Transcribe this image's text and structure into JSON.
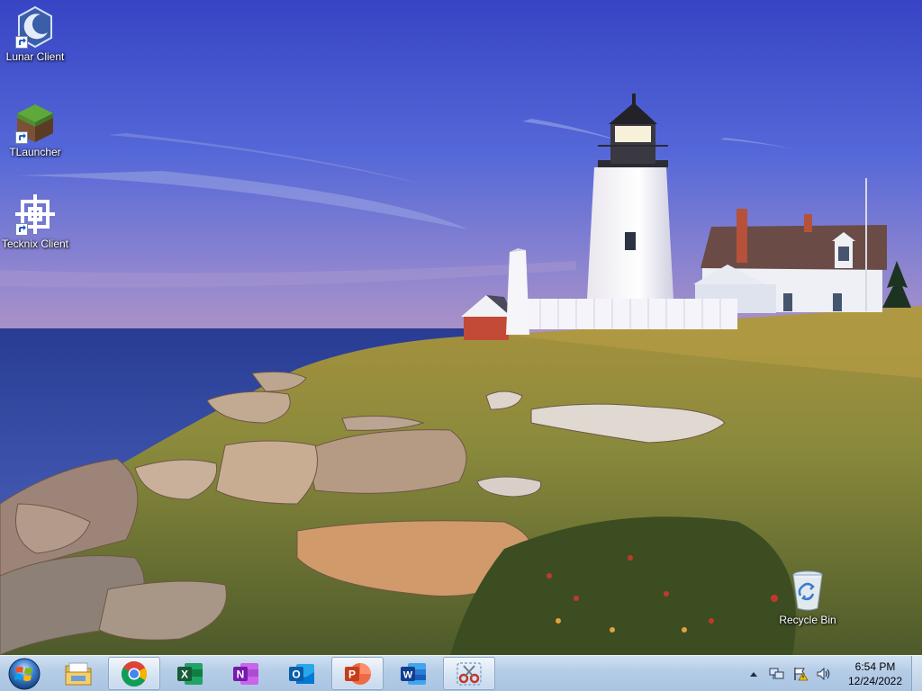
{
  "desktop": {
    "icons": [
      {
        "label": "Lunar Client"
      },
      {
        "label": "TLauncher"
      },
      {
        "label": "Tecknix Client"
      },
      {
        "label": "Recycle Bin"
      }
    ]
  },
  "taskbar": {
    "pinned": [
      {
        "name": "File Explorer",
        "icon": "folder-icon"
      },
      {
        "name": "Google Chrome",
        "icon": "chrome-icon",
        "active": true
      },
      {
        "name": "Excel",
        "icon": "excel-icon",
        "letter": "X"
      },
      {
        "name": "OneNote",
        "icon": "onenote-icon",
        "letter": "N"
      },
      {
        "name": "Outlook",
        "icon": "outlook-icon",
        "letter": "O"
      },
      {
        "name": "PowerPoint",
        "icon": "powerpoint-icon",
        "letter": "P",
        "active": true
      },
      {
        "name": "Word",
        "icon": "word-icon",
        "letter": "W"
      },
      {
        "name": "Snipping Tool",
        "icon": "snipping-tool-icon",
        "active": true
      }
    ],
    "clock": {
      "time": "6:54 PM",
      "date": "12/24/2022"
    }
  },
  "colors": {
    "excel": "#1d7a44",
    "onenote": "#7b2fa8",
    "outlook": "#0f6cbd",
    "powerpoint": "#d24726",
    "word": "#2b579a",
    "sky_top": "#3848c8",
    "sky_bottom": "#a48fc8",
    "sea": "#2a3f95",
    "grass": "#9a8a3c"
  }
}
